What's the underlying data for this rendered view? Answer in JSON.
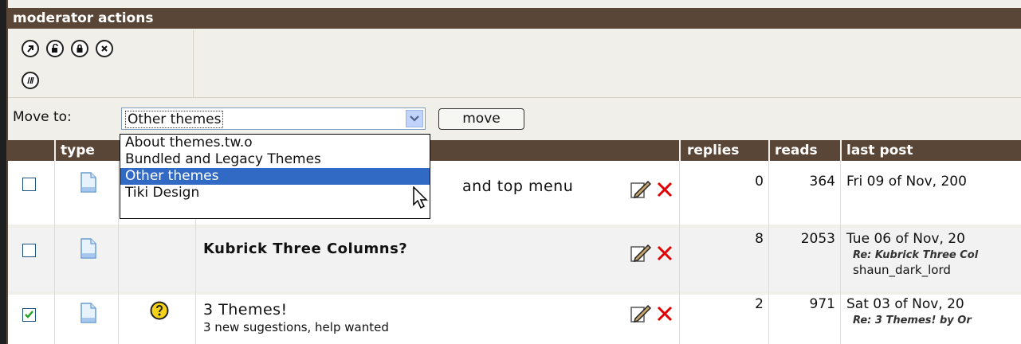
{
  "header": {
    "title": "moderator actions"
  },
  "move": {
    "label": "Move to:",
    "selected": "Other themes",
    "button": "move",
    "options": [
      "About themes.tw.o",
      "Bundled and Legacy Themes",
      "Other themes",
      "Tiki Design"
    ]
  },
  "icons": {
    "action_buttons": [
      "move-topic-icon",
      "unlock-icon",
      "lock-icon",
      "delete-icon",
      "merge-icon"
    ],
    "row_icons": [
      "document-icon",
      "edit-icon",
      "delete-x-icon",
      "hot-topic-icon"
    ]
  },
  "columns": {
    "type": "type",
    "replies": "replies",
    "reads": "reads",
    "last_post": "last post"
  },
  "rows": [
    {
      "title": "and top menu",
      "replies": "0",
      "reads": "364",
      "last_post": "Fri 09 of Nov, 200",
      "checked": false
    },
    {
      "title": "Kubrick Three Columns?",
      "replies": "8",
      "reads": "2053",
      "last_post": "Tue 06 of Nov, 20",
      "last_reply": "Re: Kubrick Three Col",
      "last_user": "shaun_dark_lord",
      "checked": false
    },
    {
      "title": "3 Themes!",
      "subtitle": "3 new sugestions, help wanted",
      "replies": "2",
      "reads": "971",
      "last_post": "Sat 03 of Nov, 20",
      "last_reply": "Re: 3 Themes! by Or",
      "checked": true
    }
  ],
  "colors": {
    "header_bg": "#5a4636",
    "panel_bg": "#f0efe9",
    "select_highlight": "#316ac5",
    "delete_red": "#e00000"
  }
}
